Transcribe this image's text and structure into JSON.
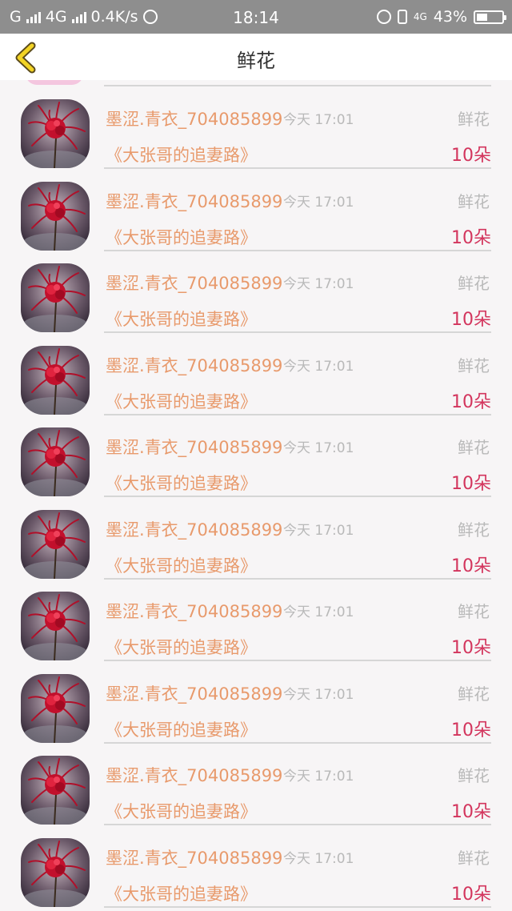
{
  "status_bar": {
    "carrier": "G",
    "network": "4G",
    "speed": "0.4K/s",
    "time": "18:14",
    "net_small": "4G",
    "battery": "43%",
    "battery_level": 0.43
  },
  "header": {
    "title": "鲜花"
  },
  "records": [
    {
      "user": "墨涩.青衣_704085899",
      "time": "今天 17:01",
      "gift": "鲜花",
      "book": "《大张哥的追妻路》",
      "amount": "10朵"
    },
    {
      "user": "墨涩.青衣_704085899",
      "time": "今天 17:01",
      "gift": "鲜花",
      "book": "《大张哥的追妻路》",
      "amount": "10朵"
    },
    {
      "user": "墨涩.青衣_704085899",
      "time": "今天 17:01",
      "gift": "鲜花",
      "book": "《大张哥的追妻路》",
      "amount": "10朵"
    },
    {
      "user": "墨涩.青衣_704085899",
      "time": "今天 17:01",
      "gift": "鲜花",
      "book": "《大张哥的追妻路》",
      "amount": "10朵"
    },
    {
      "user": "墨涩.青衣_704085899",
      "time": "今天 17:01",
      "gift": "鲜花",
      "book": "《大张哥的追妻路》",
      "amount": "10朵"
    },
    {
      "user": "墨涩.青衣_704085899",
      "time": "今天 17:01",
      "gift": "鲜花",
      "book": "《大张哥的追妻路》",
      "amount": "10朵"
    },
    {
      "user": "墨涩.青衣_704085899",
      "time": "今天 17:01",
      "gift": "鲜花",
      "book": "《大张哥的追妻路》",
      "amount": "10朵"
    },
    {
      "user": "墨涩.青衣_704085899",
      "time": "今天 17:01",
      "gift": "鲜花",
      "book": "《大张哥的追妻路》",
      "amount": "10朵"
    },
    {
      "user": "墨涩.青衣_704085899",
      "time": "今天 17:01",
      "gift": "鲜花",
      "book": "《大张哥的追妻路》",
      "amount": "10朵"
    },
    {
      "user": "墨涩.青衣_704085899",
      "time": "今天 17:01",
      "gift": "鲜花",
      "book": "《大张哥的追妻路》",
      "amount": "10朵"
    }
  ],
  "icons": {
    "back": "chevron-left-icon",
    "avatar": "red-spider-lily-avatar"
  },
  "colors": {
    "status_bar_bg": "#8e8e8e",
    "back_arrow": "#f2d324",
    "username": "#e89a6c",
    "amount": "#d3355d",
    "muted": "#b9b9b9"
  }
}
